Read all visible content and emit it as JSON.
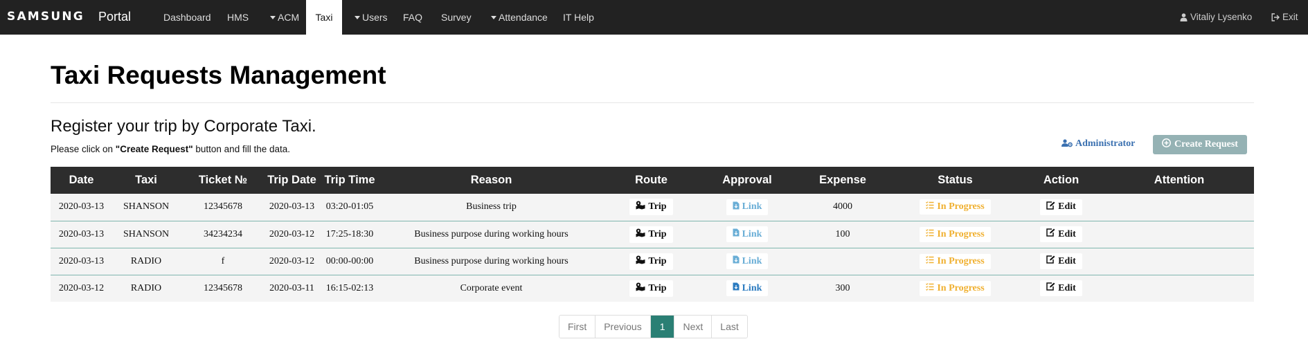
{
  "nav": {
    "brand_logo": "SAMSUNG",
    "brand_name": "Portal",
    "items": [
      {
        "label": "Dashboard",
        "dropdown": false
      },
      {
        "label": "HMS",
        "dropdown": false
      },
      {
        "label": "ACM",
        "dropdown": true
      },
      {
        "label": "Taxi",
        "dropdown": false,
        "active": true
      },
      {
        "label": "Users",
        "dropdown": true
      },
      {
        "label": "FAQ",
        "dropdown": false
      },
      {
        "label": "Survey",
        "dropdown": false
      },
      {
        "label": "Attendance",
        "dropdown": true
      },
      {
        "label": "IT Help",
        "dropdown": false
      }
    ],
    "user_name": "Vitaliy Lysenko",
    "user_icon": "user-icon",
    "exit_label": "Exit",
    "exit_icon": "sign-out-icon"
  },
  "page": {
    "title": "Taxi Requests Management",
    "subtitle": "Register your trip by Corporate Taxi.",
    "instruction_prefix": "Please click on ",
    "instruction_bold": "\"Create Request\"",
    "instruction_suffix": " button and fill the data.",
    "admin_link": "Administrator",
    "admin_icon": "users-cog-icon",
    "create_button": "Create Request",
    "create_icon": "plus-circle-icon"
  },
  "table": {
    "headers": [
      "Date",
      "Taxi",
      "Ticket №",
      "Trip Date",
      "Trip Time",
      "Reason",
      "Route",
      "Approval",
      "Expense",
      "Status",
      "Action",
      "Attention"
    ],
    "route_label": "Trip",
    "approval_label": "Link",
    "action_label": "Edit",
    "rows": [
      {
        "date": "2020-03-13",
        "taxi": "SHANSON",
        "ticket": "12345678",
        "trip_date": "2020-03-13",
        "trip_time": "03:20-01:05",
        "reason": "Business trip",
        "expense": "4000",
        "status": "In Progress",
        "attention": ""
      },
      {
        "date": "2020-03-13",
        "taxi": "SHANSON",
        "ticket": "34234234",
        "trip_date": "2020-03-12",
        "trip_time": "17:25-18:30",
        "reason": "Business purpose during working hours",
        "expense": "100",
        "status": "In Progress",
        "attention": ""
      },
      {
        "date": "2020-03-13",
        "taxi": "RADIO",
        "ticket": "f",
        "trip_date": "2020-03-12",
        "trip_time": "00:00-00:00",
        "reason": "Business purpose during working hours",
        "expense": "",
        "status": "In Progress",
        "attention": ""
      },
      {
        "date": "2020-03-12",
        "taxi": "RADIO",
        "ticket": "12345678",
        "trip_date": "2020-03-11",
        "trip_time": "16:15-02:13",
        "reason": "Corporate event",
        "expense": "300",
        "status": "In Progress",
        "attention": ""
      }
    ]
  },
  "pagination": {
    "first": "First",
    "previous": "Previous",
    "current": "1",
    "next": "Next",
    "last": "Last"
  },
  "colors": {
    "navbar": "#222222",
    "table_header": "#2d2d2d",
    "accent_teal": "#2a7f74",
    "create_button": "#95b2b4",
    "status_in_progress": "#f0b030",
    "link_blue": "#3a70b0"
  }
}
